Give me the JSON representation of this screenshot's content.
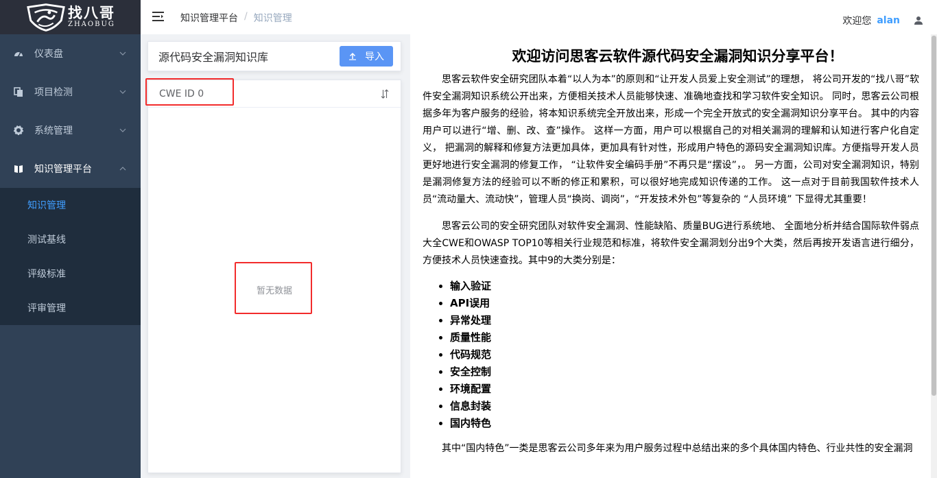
{
  "sidebar": {
    "logo_cn": "找八哥",
    "logo_en": "ZHAOBUG",
    "menu": [
      {
        "label": "仪表盘",
        "icon": "dashboard-icon"
      },
      {
        "label": "项目检测",
        "icon": "copy-icon"
      },
      {
        "label": "系统管理",
        "icon": "gear-icon"
      },
      {
        "label": "知识管理平台",
        "icon": "book-icon"
      }
    ],
    "submenu": [
      "知识管理",
      "测试基线",
      "评级标准",
      "评审管理"
    ],
    "active_submenu": "知识管理"
  },
  "header": {
    "breadcrumb": [
      "知识管理平台",
      "知识管理"
    ],
    "welcome": "欢迎您",
    "username": "alan"
  },
  "left_panel": {
    "title": "源代码安全漏洞知识库",
    "import_label": "导入",
    "list_header": "CWE ID 0",
    "empty_text": "暂无数据"
  },
  "content": {
    "title": "欢迎访问思客云软件源代码安全漏洞知识分享平台！",
    "para1": "思客云软件安全研究团队本着“以人为本”的原则和“让开发人员爱上安全测试”的理想， 将公司开发的“找八哥”软件安全漏洞知识系统公开出来，方便相关技术人员能够快速、准确地查找和学习软件安全知识。 同时，思客云公司根据多年为客户服务的经验，将本知识系统完全开放出来，形成一个完全开放式的安全漏洞知识分享平台。 其中的内容用户可以进行“增、删、改、查”操作。 这样一方面，用户可以根据自己的对相关漏洞的理解和认知进行客户化自定义， 把漏洞的解释和修复方法更加具体，更加具有针对性，形成用户特色的源码安全漏洞知识库。方便指导开发人员更好地进行安全漏洞的修复工作， “让软件安全编码手册”不再只是“摆设”，。 另一方面，公司对安全漏洞知识，特别是漏洞修复方法的经验可以不断的修正和累积，可以很好地完成知识传递的工作。 这一点对于目前我国软件技术人员“流动量大、流动快”，管理人员“换岗、调岗”，“开发技术外包”等复杂的 “人员环境” 下显得尤其重要！",
    "para2": "思客云公司的安全研究团队对软件安全漏洞、性能缺陷、质量BUG进行系统地、 全面地分析并结合国际软件弱点大全CWE和OWASP TOP10等相关行业规范和标准，将软件安全漏洞划分出9个大类，然后再按开发语言进行细分， 方便技术人员快速查找。其中9的大类分别是：",
    "categories": [
      "输入验证",
      "API误用",
      "异常处理",
      "质量性能",
      "代码规范",
      "安全控制",
      "环境配置",
      "信息封装",
      "国内特色"
    ],
    "para3": "其中“国内特色”一类是思客云公司多年来为用户服务过程中总结出来的多个具体国内特色、行业共性的安全漏洞"
  }
}
